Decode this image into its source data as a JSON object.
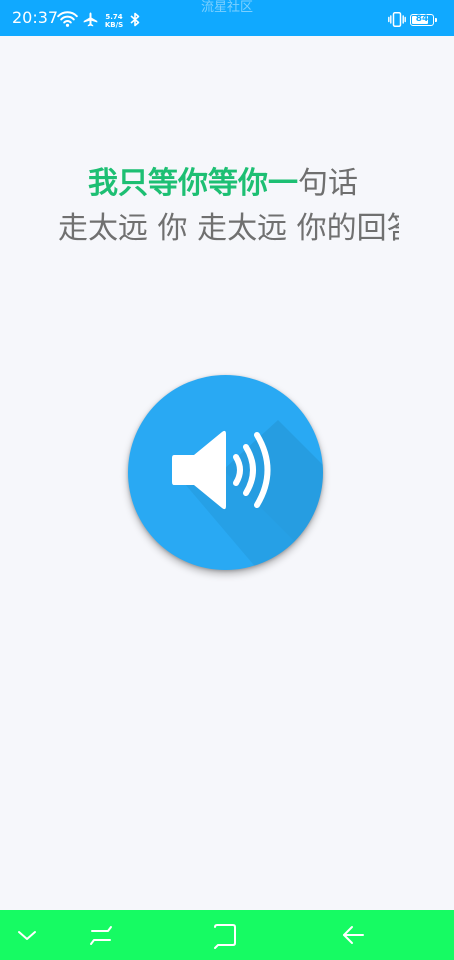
{
  "status_bar": {
    "time": "20:37",
    "watermark": "流星社区",
    "net_speed_value": "5.74",
    "net_speed_unit": "KB/S",
    "battery_level": "84",
    "background_color": "#10a9ff"
  },
  "lyrics": {
    "line1_sung": "我只等你等你一",
    "line1_unsung": "句话",
    "line2": "走太远 你 走太远 你的回答",
    "sung_color": "#1dbf73",
    "unsung_color": "#6f6f6f"
  },
  "speaker": {
    "icon": "speaker-volume-icon",
    "color": "#29a9f3"
  },
  "nav_bar": {
    "background_color": "#16fb63",
    "buttons": [
      {
        "icon": "chevron-down-icon"
      },
      {
        "icon": "recent-apps-icon"
      },
      {
        "icon": "home-icon"
      },
      {
        "icon": "back-arrow-icon"
      }
    ]
  }
}
